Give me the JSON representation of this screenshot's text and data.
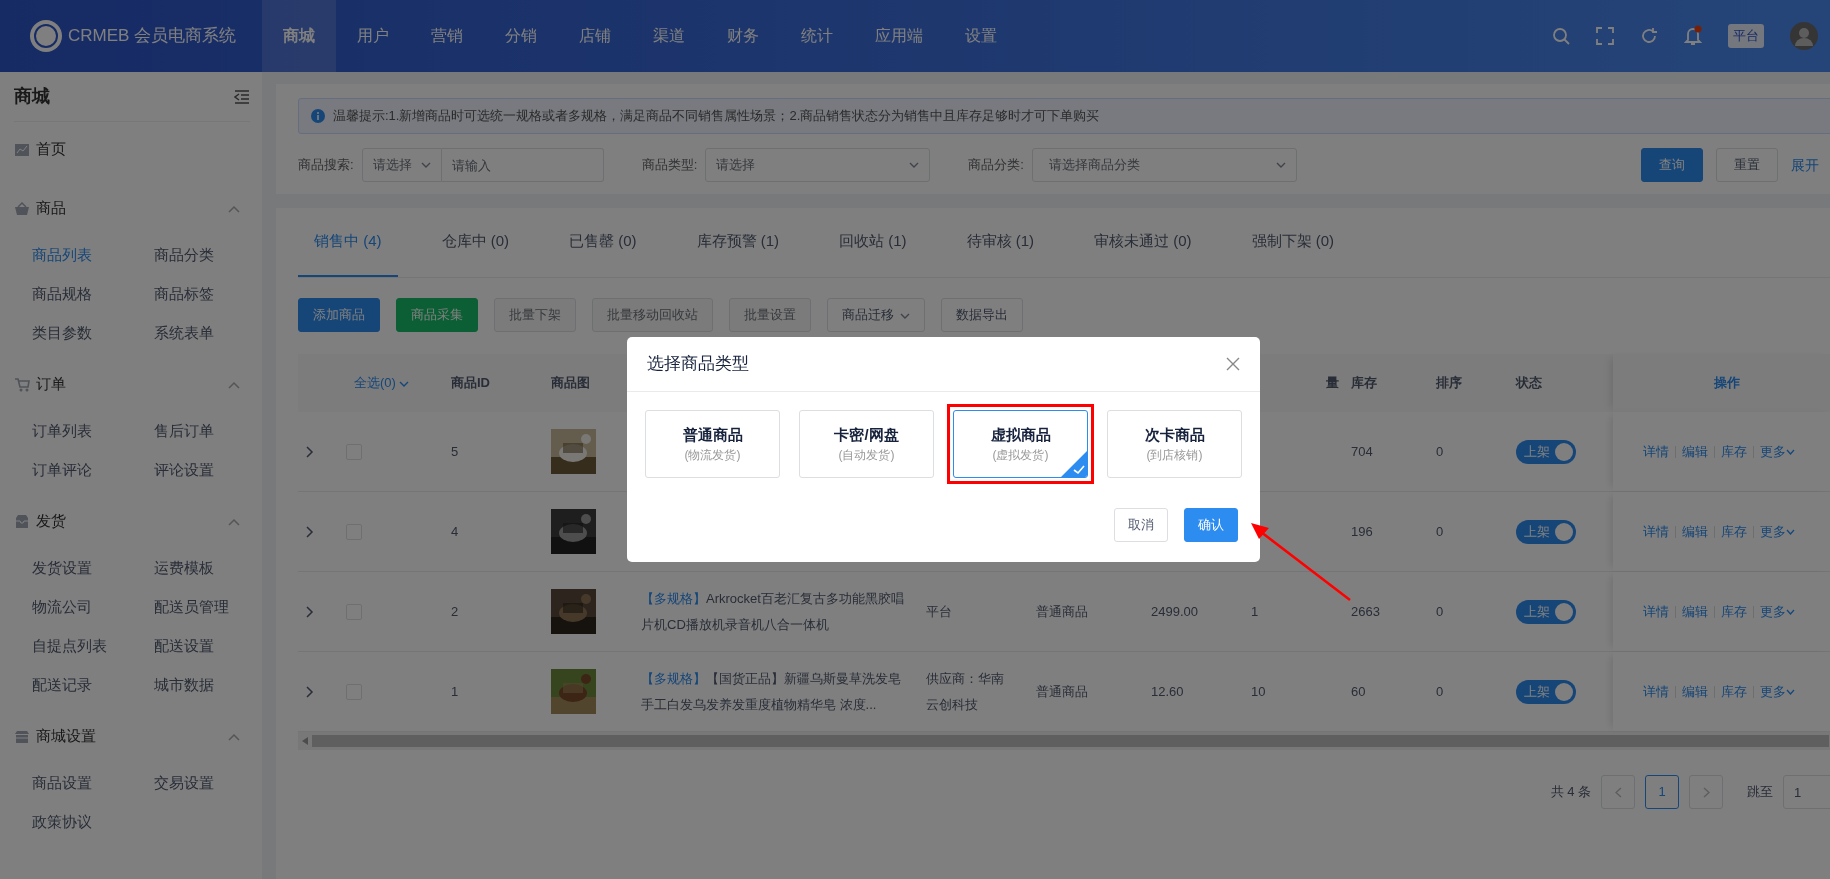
{
  "header": {
    "logo_text": "CRMEB 会员电商系统",
    "nav": [
      {
        "label": "商城",
        "selected": true
      },
      {
        "label": "用户",
        "selected": false
      },
      {
        "label": "营销",
        "selected": false
      },
      {
        "label": "分销",
        "selected": false
      },
      {
        "label": "店铺",
        "selected": false
      },
      {
        "label": "渠道",
        "selected": false
      },
      {
        "label": "财务",
        "selected": false
      },
      {
        "label": "统计",
        "selected": false
      },
      {
        "label": "应用端",
        "selected": false
      },
      {
        "label": "设置",
        "selected": false
      }
    ],
    "has_unread": true,
    "role_badge": "平台"
  },
  "sidebar": {
    "title": "商城",
    "home": {
      "label": "首页",
      "selected": false
    },
    "groups": [
      {
        "title": "商品",
        "expanded": true,
        "items": [
          {
            "label": "商品列表",
            "selected": true
          },
          {
            "label": "商品分类",
            "selected": false
          },
          {
            "label": "商品规格",
            "selected": false
          },
          {
            "label": "商品标签",
            "selected": false
          },
          {
            "label": "类目参数",
            "selected": false
          },
          {
            "label": "系统表单",
            "selected": false
          }
        ]
      },
      {
        "title": "订单",
        "expanded": true,
        "items": [
          {
            "label": "订单列表",
            "selected": false
          },
          {
            "label": "售后订单",
            "selected": false
          },
          {
            "label": "订单评论",
            "selected": false
          },
          {
            "label": "评论设置",
            "selected": false
          }
        ]
      },
      {
        "title": "发货",
        "expanded": true,
        "items": [
          {
            "label": "发货设置",
            "selected": false
          },
          {
            "label": "运费模板",
            "selected": false
          },
          {
            "label": "物流公司",
            "selected": false
          },
          {
            "label": "配送员管理",
            "selected": false
          },
          {
            "label": "自提点列表",
            "selected": false
          },
          {
            "label": "配送设置",
            "selected": false
          },
          {
            "label": "配送记录",
            "selected": false
          },
          {
            "label": "城市数据",
            "selected": false
          }
        ]
      },
      {
        "title": "商城设置",
        "expanded": true,
        "items": [
          {
            "label": "商品设置",
            "selected": false
          },
          {
            "label": "交易设置",
            "selected": false
          },
          {
            "label": "政策协议",
            "selected": false
          }
        ]
      }
    ]
  },
  "alert": "温馨提示:1.新增商品时可选统一规格或者多规格，满足商品不同销售属性场景；2.商品销售状态分为销售中且库存足够时才可下单购买",
  "filters": {
    "search": {
      "label": "商品搜索:",
      "select_placeholder": "请选择",
      "placeholder": "请输入"
    },
    "type": {
      "label": "商品类型:",
      "placeholder": "请选择"
    },
    "category": {
      "label": "商品分类:",
      "placeholder": "请选择商品分类"
    },
    "buttons": [
      {
        "label": "查询",
        "kind": "primary"
      },
      {
        "label": "重置",
        "kind": "default"
      },
      {
        "label": "展开",
        "kind": "link"
      }
    ]
  },
  "tabs": [
    {
      "label": "销售中 (4)",
      "selected": true
    },
    {
      "label": "仓库中 (0)",
      "selected": false
    },
    {
      "label": "已售罄 (0)",
      "selected": false
    },
    {
      "label": "库存预警 (1)",
      "selected": false
    },
    {
      "label": "回收站 (1)",
      "selected": false
    },
    {
      "label": "待审核 (1)",
      "selected": false
    },
    {
      "label": "审核未通过 (0)",
      "selected": false
    },
    {
      "label": "强制下架 (0)",
      "selected": false
    }
  ],
  "toolbar": [
    {
      "label": "添加商品",
      "kind": "primary"
    },
    {
      "label": "商品采集",
      "kind": "success"
    },
    {
      "label": "批量下架",
      "kind": "disabled"
    },
    {
      "label": "批量移动回收站",
      "kind": "disabled"
    },
    {
      "label": "批量设置",
      "kind": "disabled"
    },
    {
      "label": "商品迁移",
      "kind": "dropdown"
    },
    {
      "label": "数据导出",
      "kind": "default"
    }
  ],
  "table": {
    "columns": {
      "select_all": "全选(0)",
      "id": "商品ID",
      "image": "商品图",
      "sales": "量",
      "stock": "库存",
      "sort": "排序",
      "status": "状态",
      "actions": "操作"
    },
    "rows": [
      {
        "id": "5",
        "checked": false,
        "stock": "704",
        "sort": "0",
        "status": "上架",
        "on": true,
        "actions": [
          "详情",
          "编辑",
          "库存",
          "更多"
        ]
      },
      {
        "id": "4",
        "checked": false,
        "stock": "196",
        "sort": "0",
        "status": "上架",
        "on": true,
        "actions": [
          "详情",
          "编辑",
          "库存",
          "更多"
        ]
      },
      {
        "id": "2",
        "checked": false,
        "tag": "【多规格】",
        "name": "Arkrocket百老汇复古多功能黑胶唱片机CD播放机录音机八合一体机",
        "merchant": "平台",
        "type": "普通商品",
        "price": "2499.00",
        "sales": "1",
        "stock": "2663",
        "sort": "0",
        "status": "上架",
        "on": true,
        "actions": [
          "详情",
          "编辑",
          "库存",
          "更多"
        ]
      },
      {
        "id": "1",
        "checked": false,
        "tag": "【多规格】",
        "name": "【国货正品】新疆乌斯曼草洗发皂手工白发乌发养发重度植物精华皂 浓度...",
        "merchant": "供应商：华南云创科技",
        "type": "普通商品",
        "price": "12.60",
        "sales": "10",
        "stock": "60",
        "sort": "0",
        "status": "上架",
        "on": true,
        "actions": [
          "详情",
          "编辑",
          "库存",
          "更多"
        ]
      }
    ]
  },
  "pagination": {
    "total": "共 4 条",
    "pages": [
      {
        "label": "1",
        "selected": true
      }
    ],
    "jump_label": "跳至",
    "jump_value": "1"
  },
  "modal": {
    "title": "选择商品类型",
    "options": [
      {
        "title": "普通商品",
        "subtitle": "(物流发货)",
        "selected": false
      },
      {
        "title": "卡密/网盘",
        "subtitle": "(自动发货)",
        "selected": false
      },
      {
        "title": "虚拟商品",
        "subtitle": "(虚拟发货)",
        "selected": true
      },
      {
        "title": "次卡商品",
        "subtitle": "(到店核销)",
        "selected": false
      }
    ],
    "cancel": "取消",
    "confirm": "确认"
  },
  "annotation": {
    "color": "#ff0000",
    "arrow_to_confirm": true
  }
}
